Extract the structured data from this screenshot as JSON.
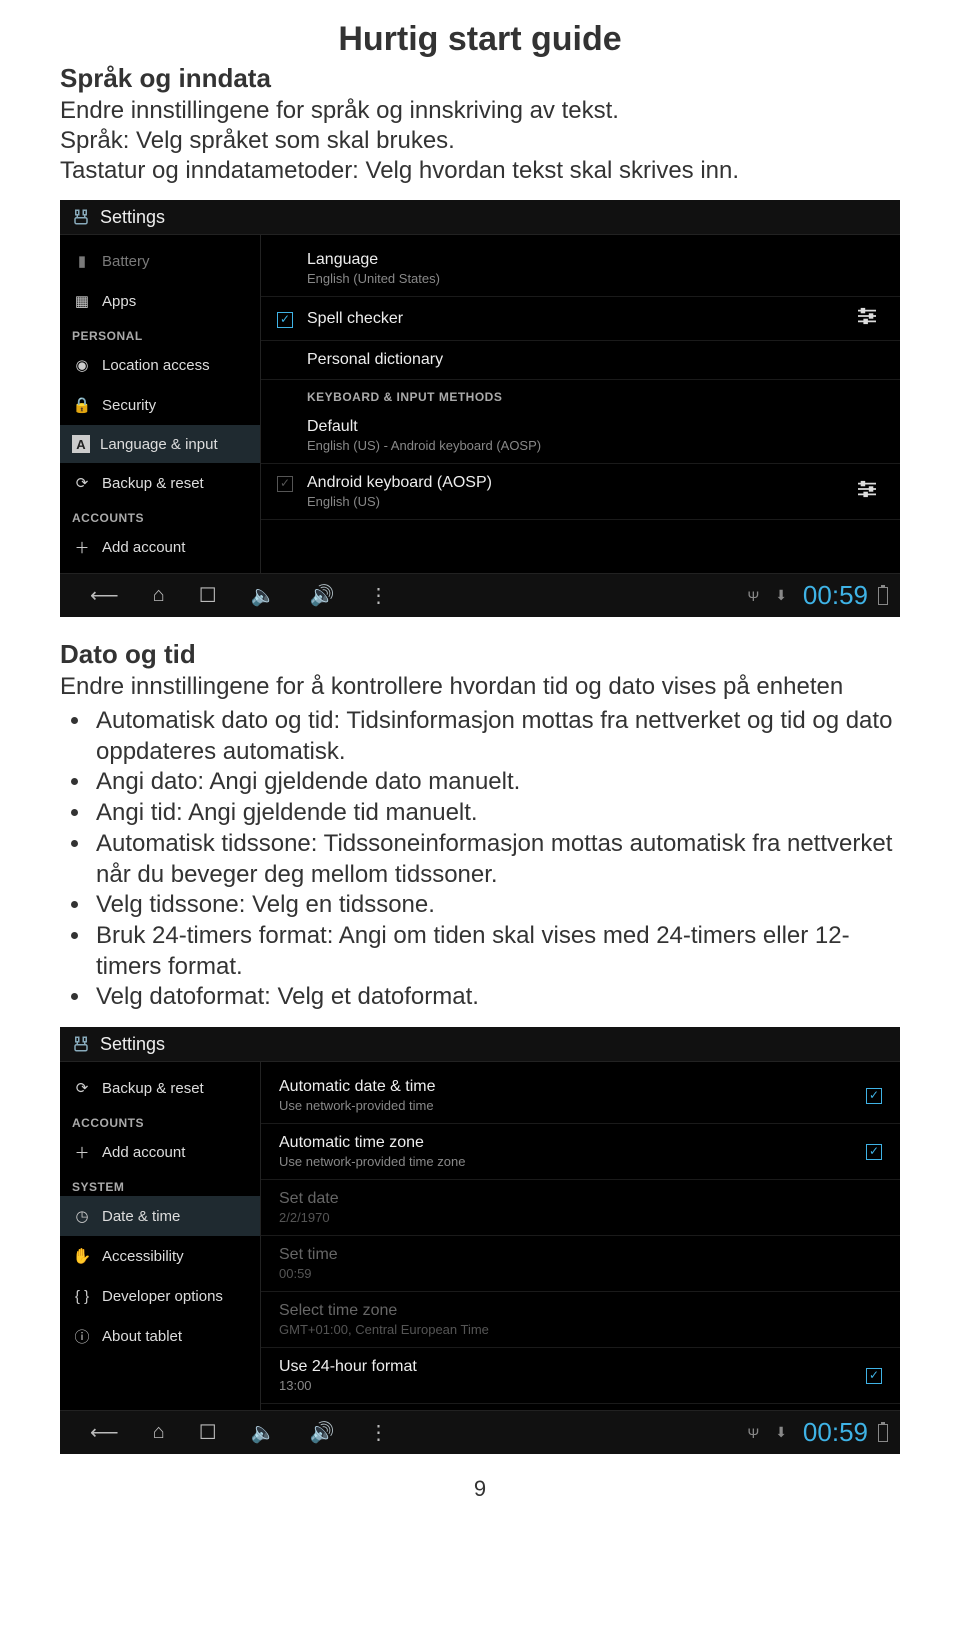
{
  "doc": {
    "title": "Hurtig start guide",
    "section1_h": "Språk og inndata",
    "section1_p1": "Endre innstillingene for språk og innskriving av tekst.",
    "section1_p2": "Språk: Velg språket som skal brukes.",
    "section1_p3": "Tastatur og inndatametoder: Velg hvordan tekst skal skrives inn.",
    "section2_h": "Dato og tid",
    "section2_p1": "Endre innstillingene for å kontrollere hvordan tid og dato vises på enheten",
    "bullets": [
      "Automatisk dato og tid: Tidsinformasjon mottas fra nettverket og tid og dato oppdateres automatisk.",
      "Angi dato: Angi gjeldende dato manuelt.",
      "Angi tid: Angi gjeldende tid manuelt.",
      "Automatisk tidssone: Tidssoneinformasjon mottas automatisk fra nettverket når du beveger deg mellom tidssoner.",
      "Velg tidssone: Velg en tidssone.",
      "Bruk 24-timers format: Angi om tiden skal vises med 24-timers eller 12-timers format.",
      "Velg datoformat: Velg et datoformat."
    ],
    "pagenum": "9"
  },
  "shot1": {
    "title": "Settings",
    "sidebar": {
      "battery": "Battery",
      "apps": "Apps",
      "cat_personal": "PERSONAL",
      "location": "Location access",
      "security": "Security",
      "lang": "Language & input",
      "backup": "Backup & reset",
      "cat_accounts": "ACCOUNTS",
      "add": "Add account"
    },
    "content": {
      "language": "Language",
      "language_sub": "English (United States)",
      "spell": "Spell checker",
      "dict": "Personal dictionary",
      "cat_kb": "KEYBOARD & INPUT METHODS",
      "default": "Default",
      "default_sub": "English (US) - Android keyboard (AOSP)",
      "kb": "Android keyboard (AOSP)",
      "kb_sub": "English (US)"
    },
    "clock": "00:59"
  },
  "shot2": {
    "title": "Settings",
    "sidebar": {
      "backup": "Backup & reset",
      "cat_accounts": "ACCOUNTS",
      "add": "Add account",
      "cat_system": "SYSTEM",
      "date": "Date & time",
      "access": "Accessibility",
      "dev": "Developer options",
      "about": "About tablet"
    },
    "content": {
      "auto_dt": "Automatic date & time",
      "auto_dt_sub": "Use network-provided time",
      "auto_tz": "Automatic time zone",
      "auto_tz_sub": "Use network-provided time zone",
      "set_date": "Set date",
      "set_date_sub": "2/2/1970",
      "set_time": "Set time",
      "set_time_sub": "00:59",
      "select_tz": "Select time zone",
      "select_tz_sub": "GMT+01:00, Central European Time",
      "use24": "Use 24-hour format",
      "use24_sub": "13:00"
    },
    "clock": "00:59"
  }
}
